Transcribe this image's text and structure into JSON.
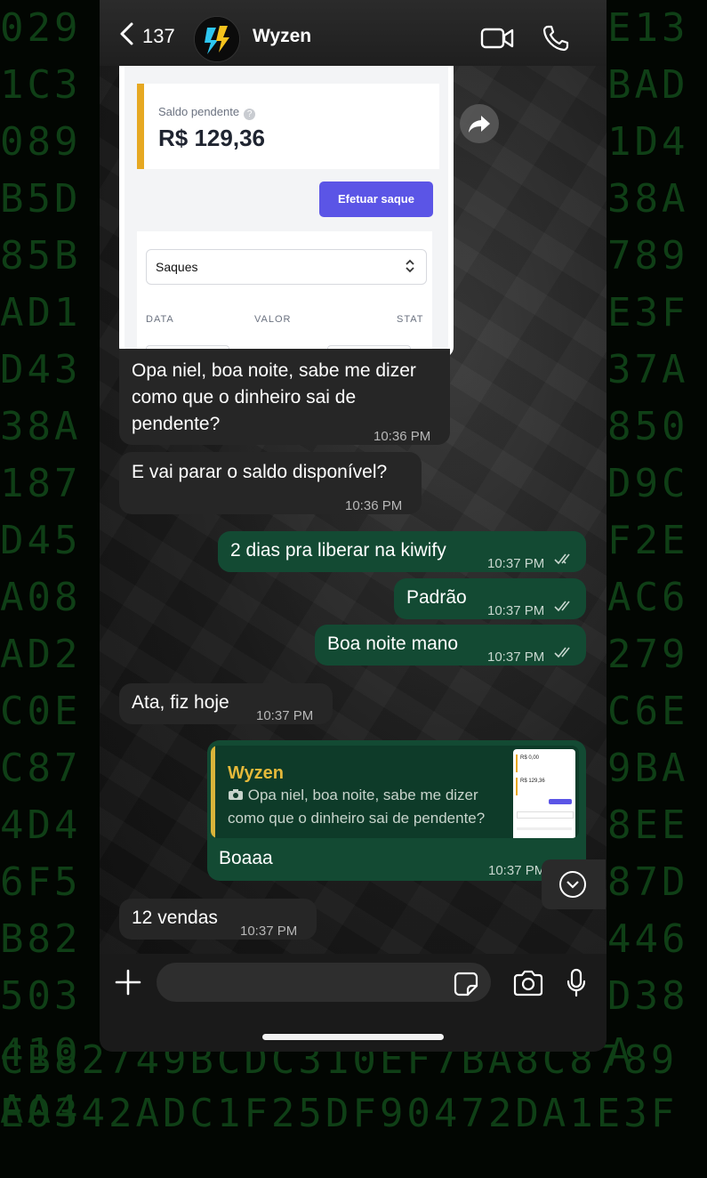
{
  "background": {
    "left_column": "0291C3089B5D85BAD1D4338A187D45A08AD2C0EC874D46F5B82503410AA4446CB82",
    "right_column": "E13BAD1D438A789E3F37A850D9CF2EAC6279C6E9BA8EE87D446D38A",
    "bottom_row_1": "CB82749BCDC310EF7BA8C8789",
    "bottom_row_2": "E0342ADC1F25DF90472DA1E3F"
  },
  "header": {
    "back_count": "137",
    "contact_name": "Wyzen"
  },
  "image_message": {
    "pending_label": "Saldo pendente",
    "help_icon_glyph": "?",
    "pending_value": "R$ 129,36",
    "withdraw_button": "Efetuar saque",
    "select_value": "Saques",
    "select_chevron": "⌃⌄",
    "col_data": "DATA",
    "col_valor": "VALOR",
    "col_status": "STAT"
  },
  "messages": [
    {
      "text": "Opa niel, boa noite, sabe me dizer como que o dinheiro sai de pendente?",
      "time": "10:36 PM",
      "direction": "in"
    },
    {
      "text": "E vai parar o saldo disponível?",
      "time": "10:36 PM",
      "direction": "in"
    },
    {
      "text": "2 dias pra liberar na kiwify",
      "time": "10:37 PM",
      "direction": "out"
    },
    {
      "text": "Padrão",
      "time": "10:37 PM",
      "direction": "out"
    },
    {
      "text": "Boa noite mano",
      "time": "10:37 PM",
      "direction": "out"
    },
    {
      "text": "Ata, fiz hoje",
      "time": "10:37 PM",
      "direction": "in"
    },
    {
      "text": "Boaaa",
      "time": "10:37 PM",
      "direction": "out"
    },
    {
      "text": "12 vendas",
      "time": "10:37 PM",
      "direction": "in"
    }
  ],
  "reply_quote": {
    "author": "Wyzen",
    "text": "Opa niel, boa noite, sabe me dizer como que o dinheiro sai de pendente?",
    "thumb_line1": "R$ 0,00",
    "thumb_line2": "R$ 129,36"
  },
  "colors": {
    "incoming_bubble": "#262626",
    "outgoing_bubble": "#134a33",
    "quote_author": "#e5b93a",
    "accent_button": "#5b55e6",
    "pending_bar": "#e6a822"
  },
  "icons": [
    "back-chevron-icon",
    "video-call-icon",
    "phone-call-icon",
    "forward-icon",
    "scroll-down-icon",
    "plus-icon",
    "sticker-icon",
    "camera-icon",
    "microphone-icon",
    "double-check-icon"
  ]
}
